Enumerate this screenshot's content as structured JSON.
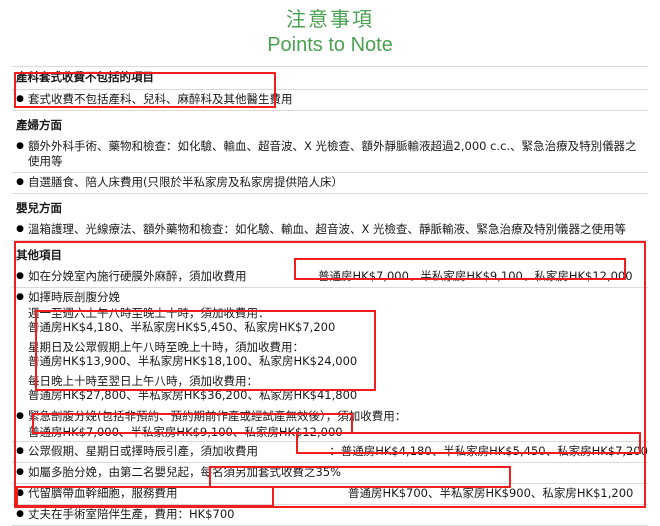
{
  "title": {
    "zh": "注意事項",
    "en": "Points to Note",
    "color": "#4aa151"
  },
  "annotation": {
    "color": "#f41d1d"
  },
  "sections": [
    {
      "id": "excluded",
      "heading": "產科套式收費不包括的項目",
      "items": [
        {
          "text": "套式收費不包括產科、兒科、麻醉科及其他醫生費用"
        }
      ]
    },
    {
      "id": "mother",
      "heading": "產婦方面",
      "items": [
        {
          "text": "額外外科手術、藥物和檢查：如化驗、輸血、超音波、X 光檢查、額外靜脈輸液超過2,000 c.c.、緊急治療及特別儀器之使用等"
        },
        {
          "text": "自選膳食、陪人床費用(只限於半私家房及私家房提供陪人床）"
        }
      ]
    },
    {
      "id": "baby",
      "heading": "嬰兒方面",
      "items": [
        {
          "text": "溫箱護理、光線療法、額外藥物和檢查：如化驗、輸血、超音波、X 光檢查、靜脈輸液、緊急治療及特別儀器之使用等"
        }
      ]
    },
    {
      "id": "others",
      "heading": "其他項目",
      "items": [
        {
          "text": "如在分娩室內施行硬膜外麻醉，須加收費用"
        },
        {
          "text": "如擇時辰剖腹分娩"
        },
        {
          "text": "緊急剖腹分娩(包括非預約、預約期前作產或經試產無效後），須加收費用："
        },
        {
          "text": "公眾假期、星期日或擇時辰引產，須加收費用"
        },
        {
          "text": "如屬多胎分娩，由第二名嬰兒起，每名須另加套式收費之35%"
        },
        {
          "text": "代留臍帶血幹細胞，服務費用"
        },
        {
          "text": "丈夫在手術室陪伴生產，費用：HK$700"
        }
      ]
    }
  ],
  "prices": {
    "epidural": "普通房HK$7,000、半私家房HK$9,100、私家房HK$12,000",
    "elective_weekday_label": "週一至週六上午八時至晚上十時，須加收費用：",
    "elective_weekday": "普通房HK$4,180、半私家房HK$5,450、私家房HK$7,200",
    "elective_sunday_label": "星期日及公眾假期上午八時至晚上十時，須加收費用：",
    "elective_sunday": "普通房HK$13,900、半私家房HK$18,100、私家房HK$24,000",
    "elective_night_label": "每日晚上十時至翌日上午八時，須加收費用：",
    "elective_night": "普通房HK$27,800、半私家房HK$36,200、私家房HK$41,800",
    "emergency_csection": "普通房HK$7,000、半私家房HK$9,100、私家房HK$12,000",
    "induction_prefix": "：",
    "induction": "普通房HK$4,180、半私家房HK$5,450、私家房HK$7,200",
    "cord_blood": "普通房HK$700、半私家房HK$900、私家房HK$1,200"
  },
  "bullet_glyph": "●"
}
